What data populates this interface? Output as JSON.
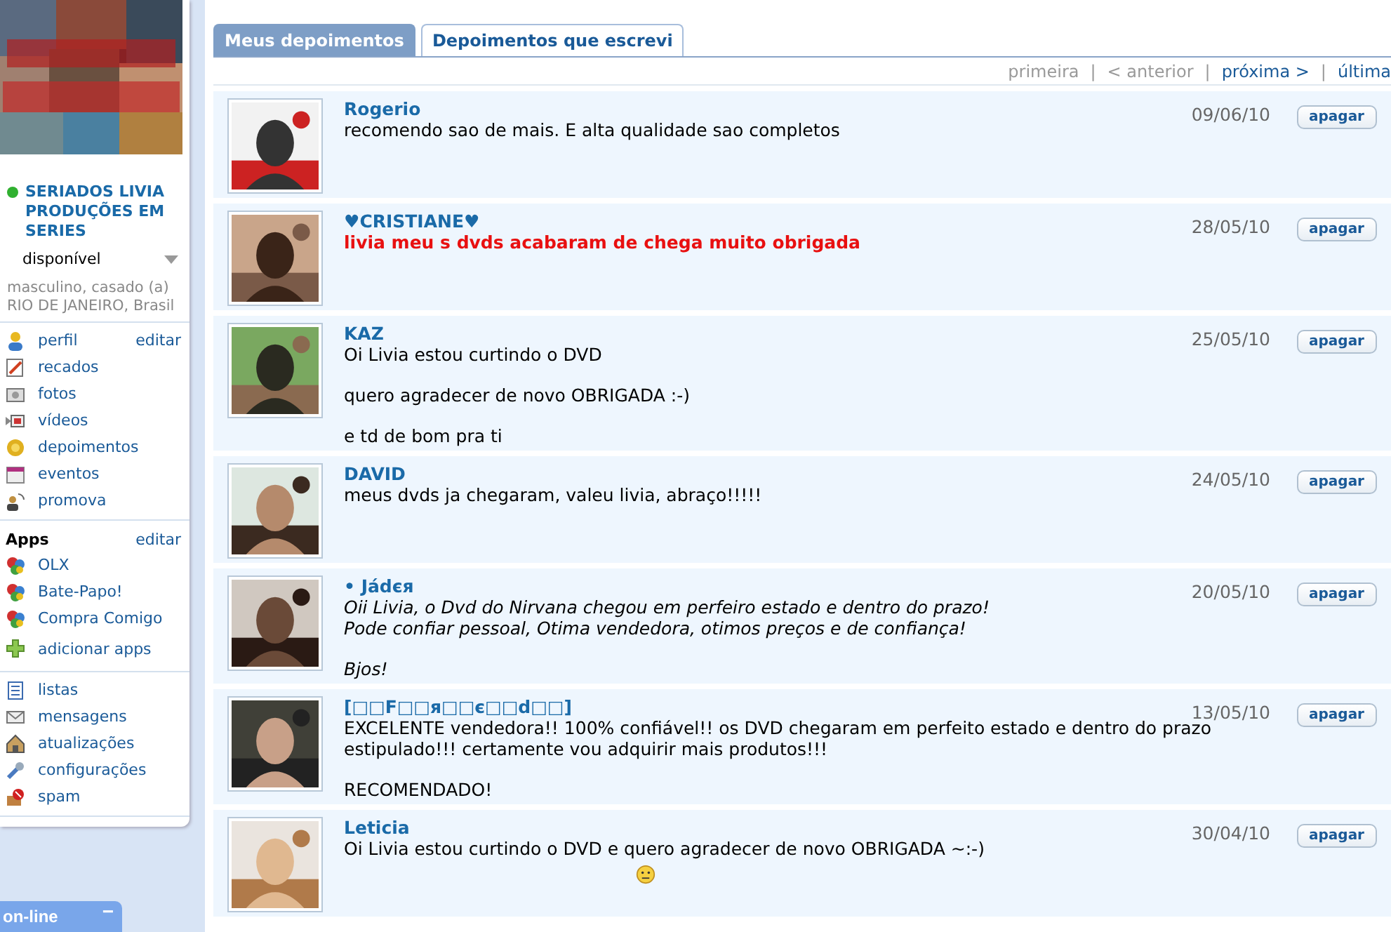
{
  "sidebar": {
    "name": "SERIADOS LIVIA PRODUÇÕES EM SERIES",
    "online": true,
    "status": "disponível",
    "details": "masculino, casado (a)\nRIO DE JANEIRO, Brasil",
    "menu": [
      {
        "label": "perfil",
        "action": "editar"
      },
      {
        "label": "recados"
      },
      {
        "label": "fotos"
      },
      {
        "label": "vídeos"
      },
      {
        "label": "depoimentos"
      },
      {
        "label": "eventos"
      },
      {
        "label": "promova"
      }
    ],
    "apps_title": "Apps",
    "apps_action": "editar",
    "apps": [
      {
        "label": "OLX"
      },
      {
        "label": "Bate-Papo!"
      },
      {
        "label": "Compra Comigo"
      },
      {
        "label": "adicionar apps"
      }
    ],
    "more": [
      {
        "label": "listas"
      },
      {
        "label": "mensagens"
      },
      {
        "label": "atualizações"
      },
      {
        "label": "configurações"
      },
      {
        "label": "spam"
      }
    ]
  },
  "chat_bar": {
    "label": "on-line",
    "button": "−"
  },
  "tabs": [
    {
      "label": "Meus depoimentos",
      "selected": true
    },
    {
      "label": "Depoimentos que escrevi",
      "selected": false
    }
  ],
  "pager_separator": "|",
  "pager": [
    {
      "label": "primeira",
      "disabled": true
    },
    {
      "label": "< anterior",
      "disabled": true
    },
    {
      "label": "próxima >",
      "disabled": false
    },
    {
      "label": "última",
      "disabled": false
    }
  ],
  "testimonials": [
    {
      "name": "Rogerio",
      "kind": "plain",
      "paragraphs": [
        "recomendo sao de mais. E alta qualidade sao completos"
      ],
      "date": "09/06/10",
      "button": "apagar",
      "emoticon": false
    },
    {
      "name": "♥CRISTIANE♥",
      "kind": "emphasis",
      "paragraphs": [
        "livia meu s dvds acabaram de chega muito obrigada"
      ],
      "date": "28/05/10",
      "button": "apagar",
      "emoticon": false
    },
    {
      "name": "KAZ",
      "kind": "plain",
      "paragraphs": [
        "Oi Livia estou curtindo o DVD",
        "quero agradecer de novo OBRIGADA :-)",
        "e td de bom pra ti"
      ],
      "date": "25/05/10",
      "button": "apagar",
      "emoticon": false
    },
    {
      "name": "DAVID",
      "kind": "plain",
      "paragraphs": [
        "meus dvds ja chegaram, valeu livia, abraço!!!!!"
      ],
      "date": "24/05/10",
      "button": "apagar",
      "emoticon": false
    },
    {
      "name": "• Jádєя",
      "kind": "slanted",
      "paragraphs": [
        "Oii Livia, o Dvd do Nirvana chegou em perfeiro estado e dentro do prazo!\nPode confiar pessoal, Otima vendedora, otimos preços e de confiança!",
        "Bjos!"
      ],
      "date": "20/05/10",
      "button": "apagar",
      "emoticon": false
    },
    {
      "name": "[□□F□□я□□є□□d□□]",
      "kind": "plain",
      "paragraphs": [
        "EXCELENTE vendedora!! 100% confiável!! os DVD chegaram em perfeito estado e dentro do prazo estipulado!!! certamente vou adquirir mais produtos!!!",
        "RECOMENDADO!"
      ],
      "date": "13/05/10",
      "button": "apagar",
      "emoticon": false
    },
    {
      "name": "Leticia",
      "kind": "plain",
      "paragraphs": [
        "Oi Livia estou curtindo o DVD e quero agradecer de novo OBRIGADA ~:-)"
      ],
      "date": "30/04/10",
      "button": "apagar",
      "emoticon": true
    }
  ]
}
